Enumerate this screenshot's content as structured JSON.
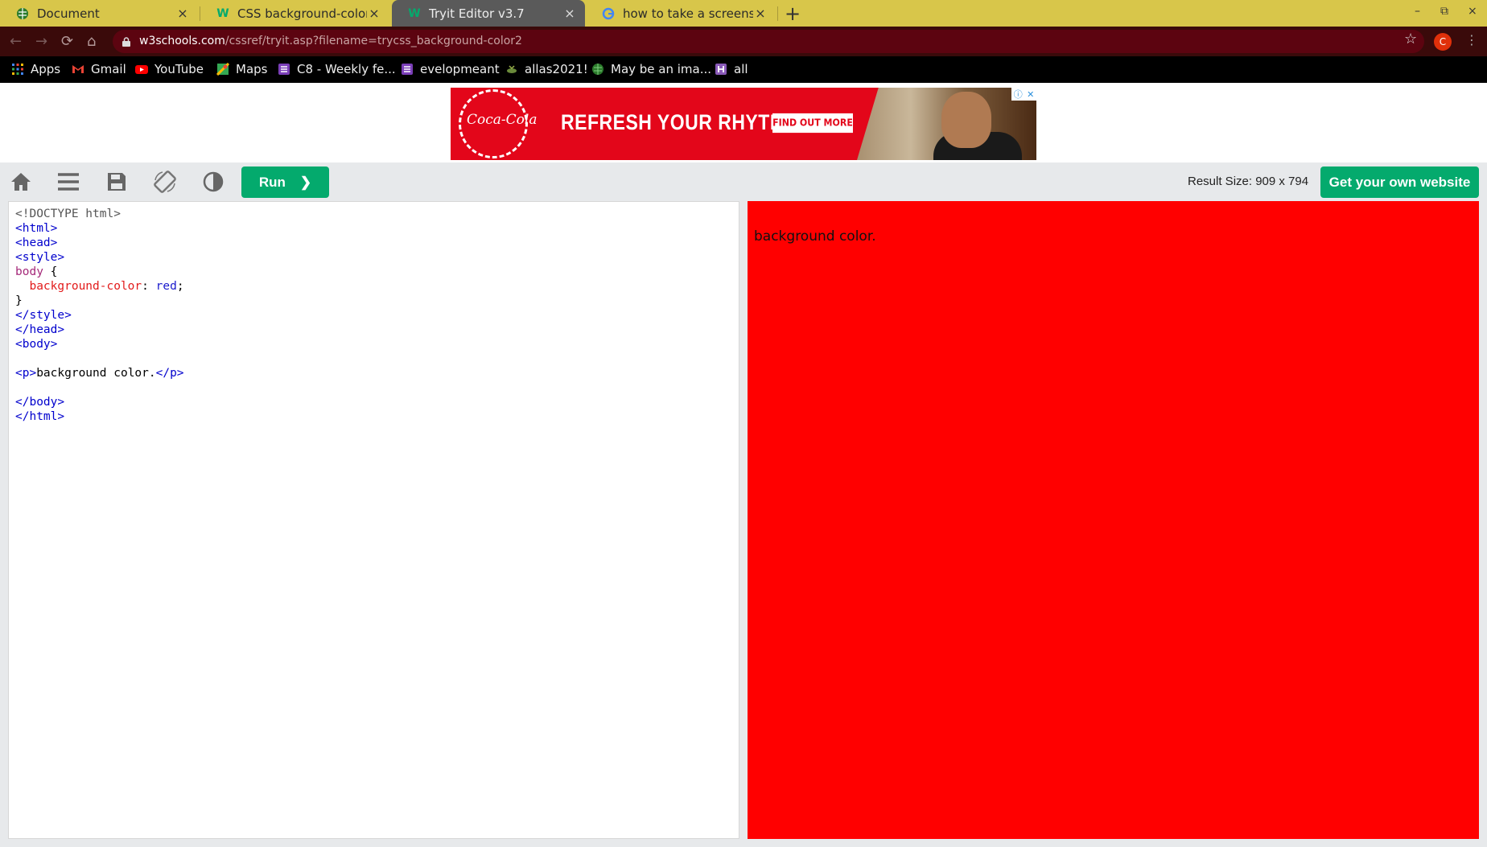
{
  "browser": {
    "tabs": [
      {
        "title": "Document",
        "icon": "document-globe-icon",
        "active": false
      },
      {
        "title": "CSS background-color pro",
        "icon": "w3schools-icon",
        "active": false
      },
      {
        "title": "Tryit Editor v3.7",
        "icon": "w3schools-icon",
        "active": true
      },
      {
        "title": "how to take a screenshot",
        "icon": "google-icon",
        "active": false
      }
    ],
    "new_tab": "+",
    "close_glyph": "×",
    "window_controls": [
      "–",
      "⧉",
      "×"
    ],
    "url_host": "w3schools.com",
    "url_path": "/cssref/tryit.asp?filename=trycss_background-color2",
    "profile_initial": "C"
  },
  "bookmarks": [
    {
      "label": "Apps",
      "icon": "apps-grid-icon"
    },
    {
      "label": "Gmail",
      "icon": "gmail-icon"
    },
    {
      "label": "YouTube",
      "icon": "youtube-icon"
    },
    {
      "label": "Maps",
      "icon": "maps-icon"
    },
    {
      "label": "C8 - Weekly fe...",
      "icon": "list-icon"
    },
    {
      "label": "evelopmeant",
      "icon": "list-icon"
    },
    {
      "label": "allas2021!",
      "icon": "bookmark-icon"
    },
    {
      "label": "May be an ima...",
      "icon": "globe-icon"
    },
    {
      "label": "all",
      "icon": "h-icon"
    }
  ],
  "ad": {
    "brand": "Coca-Cola",
    "headline": "REFRESH YOUR RHYTHM",
    "cta": "FIND OUT MORE",
    "info_glyph": "ⓘ",
    "close_glyph": "✕"
  },
  "editor_toolbar": {
    "run_label": "Run",
    "run_arrow": "❯",
    "result_size": "Result Size: 909 x 794",
    "get_website": "Get your own website"
  },
  "code_lines": [
    "<!DOCTYPE html>",
    "<html>",
    "<head>",
    "<style>",
    "body {",
    "  background-color: red;",
    "}",
    "</style>",
    "</head>",
    "<body>",
    "",
    "<p>background color.</p>",
    "",
    "</body>",
    "</html>"
  ],
  "code": {
    "doctype": "<!DOCTYPE html>",
    "html_open": "<html>",
    "head_open": "<head>",
    "style_open": "<style>",
    "selector": "body",
    "brace_open": " {",
    "property": "background-color",
    "colon": ": ",
    "value": "red",
    "semicolon": ";",
    "brace_close": "}",
    "style_close": "</style>",
    "head_close": "</head>",
    "body_open": "<body>",
    "p_open": "<p>",
    "p_text": "background color.",
    "p_close": "</p>",
    "body_close": "</body>",
    "html_close": "</html>"
  },
  "result": {
    "text": "background color.",
    "background": "#ff0000"
  },
  "colors": {
    "tabstrip": "#d8c64a",
    "toolbar": "#3a0a0a",
    "omnibox": "#5c0410",
    "w3_green": "#04aa6d"
  }
}
